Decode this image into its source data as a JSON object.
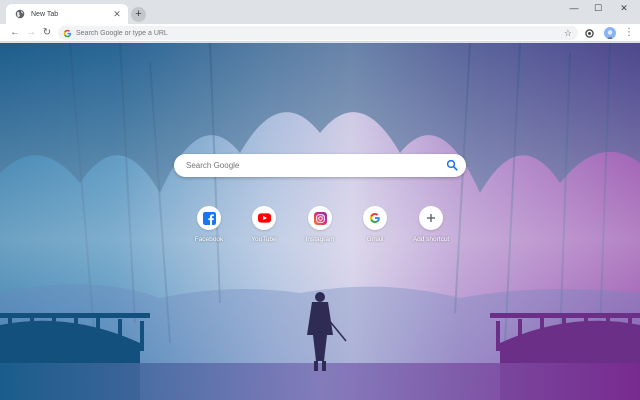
{
  "tab": {
    "title": "New Tab",
    "close_glyph": "✕",
    "new_tab_glyph": "+"
  },
  "window_controls": {
    "minimize": "—",
    "maximize": "☐",
    "close": "✕"
  },
  "toolbar": {
    "back_glyph": "←",
    "forward_glyph": "→",
    "reload_glyph": "↻",
    "address_placeholder": "Search Google or type a URL",
    "star_glyph": "☆",
    "menu_glyph": "⋮"
  },
  "search": {
    "placeholder": "Search Google"
  },
  "shortcuts": [
    {
      "label": "Facebook",
      "icon": "facebook-icon"
    },
    {
      "label": "YouTube",
      "icon": "youtube-icon"
    },
    {
      "label": "Instagram",
      "icon": "instagram-icon"
    },
    {
      "label": "Gmail",
      "icon": "google-icon"
    },
    {
      "label": "Add shortcut",
      "icon": "plus-icon"
    }
  ],
  "colors": {
    "facebook": "#1877f2",
    "youtube": "#ff0000",
    "instagram_from": "#f58529",
    "instagram_to": "#8134af",
    "google_blue": "#4285f4",
    "google_red": "#ea4335",
    "google_yellow": "#fbbc05",
    "google_green": "#34a853",
    "search_accent": "#1a73e8"
  }
}
